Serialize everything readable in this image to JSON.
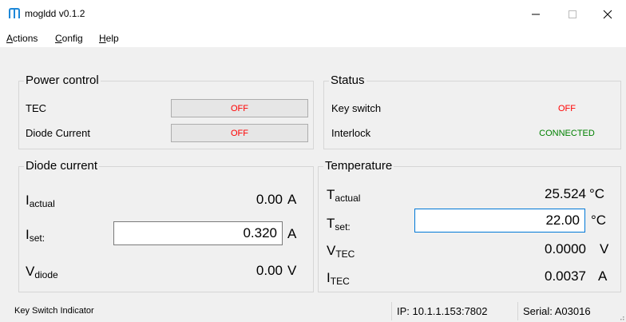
{
  "window": {
    "title": "mogldd v0.1.2"
  },
  "menu": [
    "Actions",
    "Config",
    "Help"
  ],
  "power_control": {
    "title": "Power control",
    "rows": [
      {
        "label": "TEC",
        "state": "OFF"
      },
      {
        "label": "Diode Current",
        "state": "OFF"
      }
    ]
  },
  "status": {
    "title": "Status",
    "rows": [
      {
        "label": "Key switch",
        "value": "OFF",
        "color": "#ff0000"
      },
      {
        "label": "Interlock",
        "value": "CONNECTED",
        "color": "#008000"
      }
    ]
  },
  "diode": {
    "title": "Diode current",
    "actual": {
      "sym": "I",
      "sub": "actual",
      "value": "0.00",
      "unit": "A"
    },
    "set": {
      "sym": "I",
      "sub": "set:",
      "value": "0.320",
      "unit": "A"
    },
    "vdiode": {
      "sym": "V",
      "sub": "diode",
      "value": "0.00",
      "unit": "V"
    }
  },
  "temperature": {
    "title": "Temperature",
    "actual": {
      "sym": "T",
      "sub": "actual",
      "value": "25.524",
      "unit": "°C"
    },
    "set": {
      "sym": "T",
      "sub": "set:",
      "value": "22.00",
      "unit": "°C"
    },
    "vtec": {
      "sym": "V",
      "sub": "TEC",
      "value": "0.0000",
      "unit": "V"
    },
    "itec": {
      "sym": "I",
      "sub": "TEC",
      "value": "0.0037",
      "unit": "A"
    }
  },
  "statusbar": {
    "message": "Key Switch Indicator",
    "ip": "IP: 10.1.1.153:7802",
    "serial": "Serial: A03016"
  },
  "colors": {
    "off": "#ff0000",
    "connected": "#008000",
    "focus": "#0078d7"
  }
}
